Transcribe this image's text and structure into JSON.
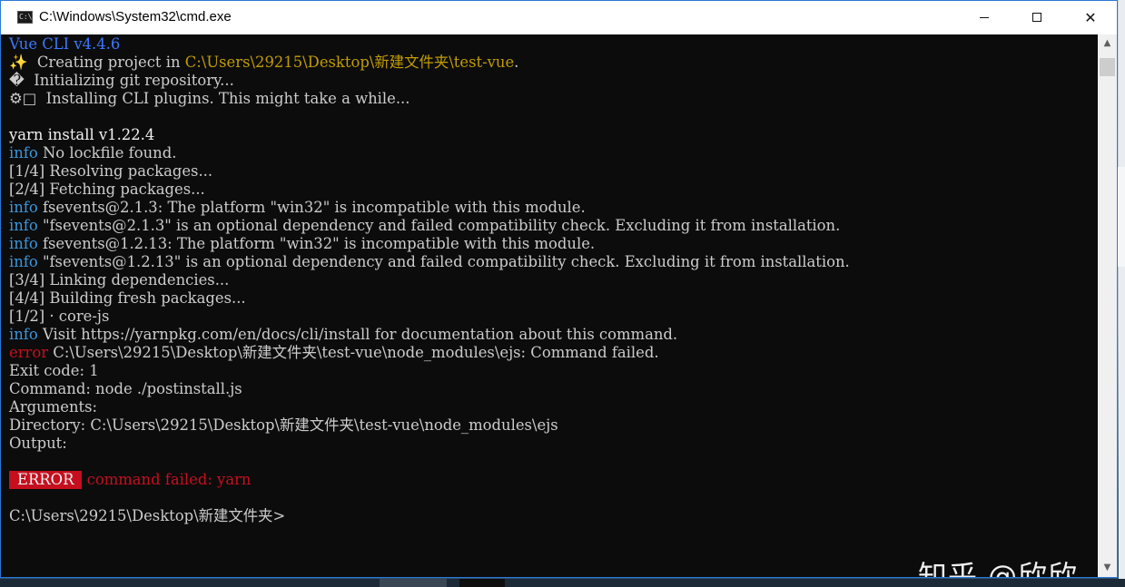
{
  "window": {
    "title": "C:\\Windows\\System32\\cmd.exe",
    "icon_text": "C:\\",
    "minimize_label": "minimize",
    "maximize_label": "maximize",
    "close_glyph": "✕"
  },
  "console": {
    "lines": [
      [
        {
          "t": "Vue CLI v4.4.6",
          "c": "c-blue"
        }
      ],
      [
        {
          "t": "✨  Creating project in ",
          "c": ""
        },
        {
          "t": "C:\\Users\\29215\\Desktop\\新建文件夹\\test-vue",
          "c": "c-yellow"
        },
        {
          "t": ".",
          "c": ""
        }
      ],
      [
        {
          "t": "�  Initializing git repository...",
          "c": ""
        }
      ],
      [
        {
          "t": "⚙□  Installing CLI plugins. This might take a while...",
          "c": ""
        }
      ],
      [
        {
          "t": "",
          "c": ""
        }
      ],
      [
        {
          "t": "yarn install v1.22.4",
          "c": "c-white"
        }
      ],
      [
        {
          "t": "info",
          "c": "c-info"
        },
        {
          "t": " No lockfile found.",
          "c": ""
        }
      ],
      [
        {
          "t": "[1/4] Resolving packages...",
          "c": ""
        }
      ],
      [
        {
          "t": "[2/4] Fetching packages...",
          "c": ""
        }
      ],
      [
        {
          "t": "info",
          "c": "c-info"
        },
        {
          "t": " fsevents@2.1.3: The platform \"win32\" is incompatible with this module.",
          "c": ""
        }
      ],
      [
        {
          "t": "info",
          "c": "c-info"
        },
        {
          "t": " \"fsevents@2.1.3\" is an optional dependency and failed compatibility check. Excluding it from installation.",
          "c": ""
        }
      ],
      [
        {
          "t": "info",
          "c": "c-info"
        },
        {
          "t": " fsevents@1.2.13: The platform \"win32\" is incompatible with this module.",
          "c": ""
        }
      ],
      [
        {
          "t": "info",
          "c": "c-info"
        },
        {
          "t": " \"fsevents@1.2.13\" is an optional dependency and failed compatibility check. Excluding it from installation.",
          "c": ""
        }
      ],
      [
        {
          "t": "[3/4] Linking dependencies...",
          "c": ""
        }
      ],
      [
        {
          "t": "[4/4] Building fresh packages...",
          "c": ""
        }
      ],
      [
        {
          "t": "[1/2] · core-js",
          "c": ""
        }
      ],
      [
        {
          "t": "info",
          "c": "c-info"
        },
        {
          "t": " Visit https://yarnpkg.com/en/docs/cli/install for documentation about this command.",
          "c": ""
        }
      ],
      [
        {
          "t": "error",
          "c": "c-err"
        },
        {
          "t": " C:\\Users\\29215\\Desktop\\新建文件夹\\test-vue\\node_modules\\ejs: Command failed.",
          "c": ""
        }
      ],
      [
        {
          "t": "Exit code: 1",
          "c": ""
        }
      ],
      [
        {
          "t": "Command: node ./postinstall.js",
          "c": ""
        }
      ],
      [
        {
          "t": "Arguments:",
          "c": ""
        }
      ],
      [
        {
          "t": "Directory: C:\\Users\\29215\\Desktop\\新建文件夹\\test-vue\\node_modules\\ejs",
          "c": ""
        }
      ],
      [
        {
          "t": "Output:",
          "c": ""
        }
      ],
      [
        {
          "t": "",
          "c": ""
        }
      ],
      [
        {
          "t": "ERROR",
          "c": "err-badge"
        },
        {
          "t": " command failed: yarn",
          "c": "c-err"
        }
      ],
      [
        {
          "t": "",
          "c": ""
        }
      ],
      [
        {
          "t": "C:\\Users\\29215\\Desktop\\新建文件夹>",
          "c": ""
        }
      ]
    ]
  },
  "watermark": "知乎 @欣欣",
  "scrollbar": {
    "up_arrow": "▲",
    "down_arrow": "▼"
  }
}
